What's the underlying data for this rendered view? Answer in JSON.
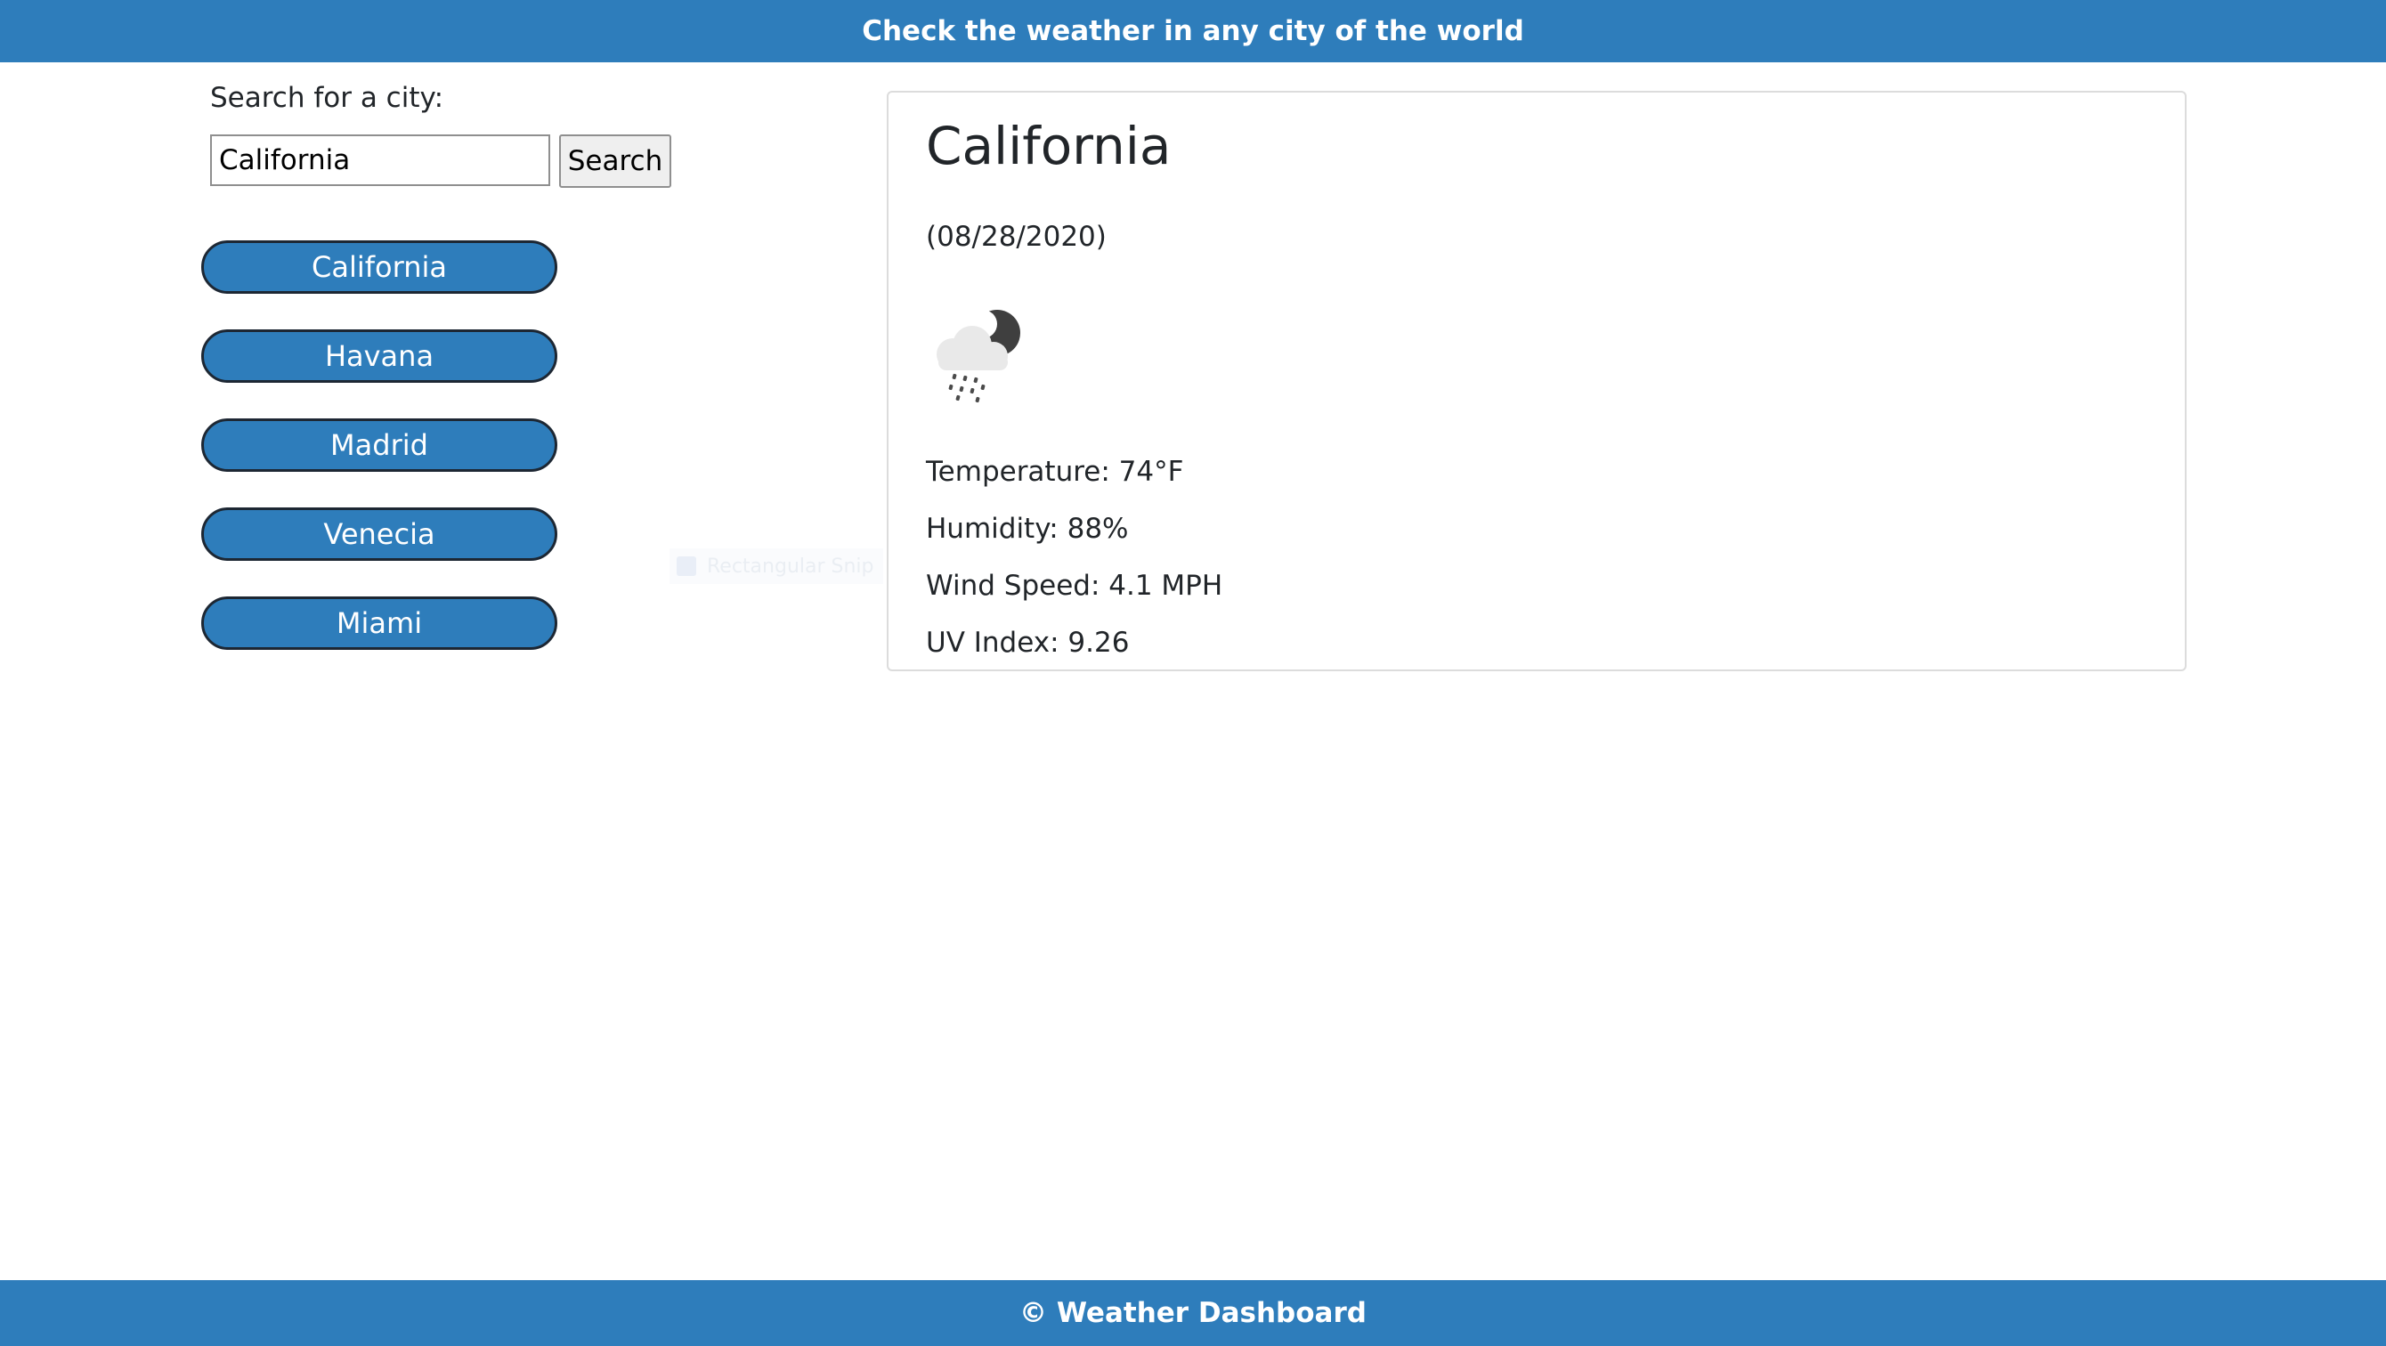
{
  "header": {
    "title": "Check the weather in any city of the world"
  },
  "search": {
    "label": "Search for a city:",
    "value": "California",
    "button_label": "Search"
  },
  "cities": [
    {
      "label": "California"
    },
    {
      "label": "Havana"
    },
    {
      "label": "Madrid"
    },
    {
      "label": "Venecia"
    },
    {
      "label": "Miami"
    }
  ],
  "weather": {
    "city": "California",
    "date": "(08/28/2020)",
    "icon": "night-rain-cloud-icon",
    "temperature": "Temperature: 74°F",
    "humidity": "Humidity: 88%",
    "wind_speed": "Wind Speed: 4.1 MPH",
    "uv_index": "UV Index: 9.26"
  },
  "overlay": {
    "label": "Rectangular Snip"
  },
  "footer": {
    "text": "© Weather Dashboard"
  },
  "colors": {
    "primary": "#2e7dbb",
    "button_border": "#1d2733"
  }
}
